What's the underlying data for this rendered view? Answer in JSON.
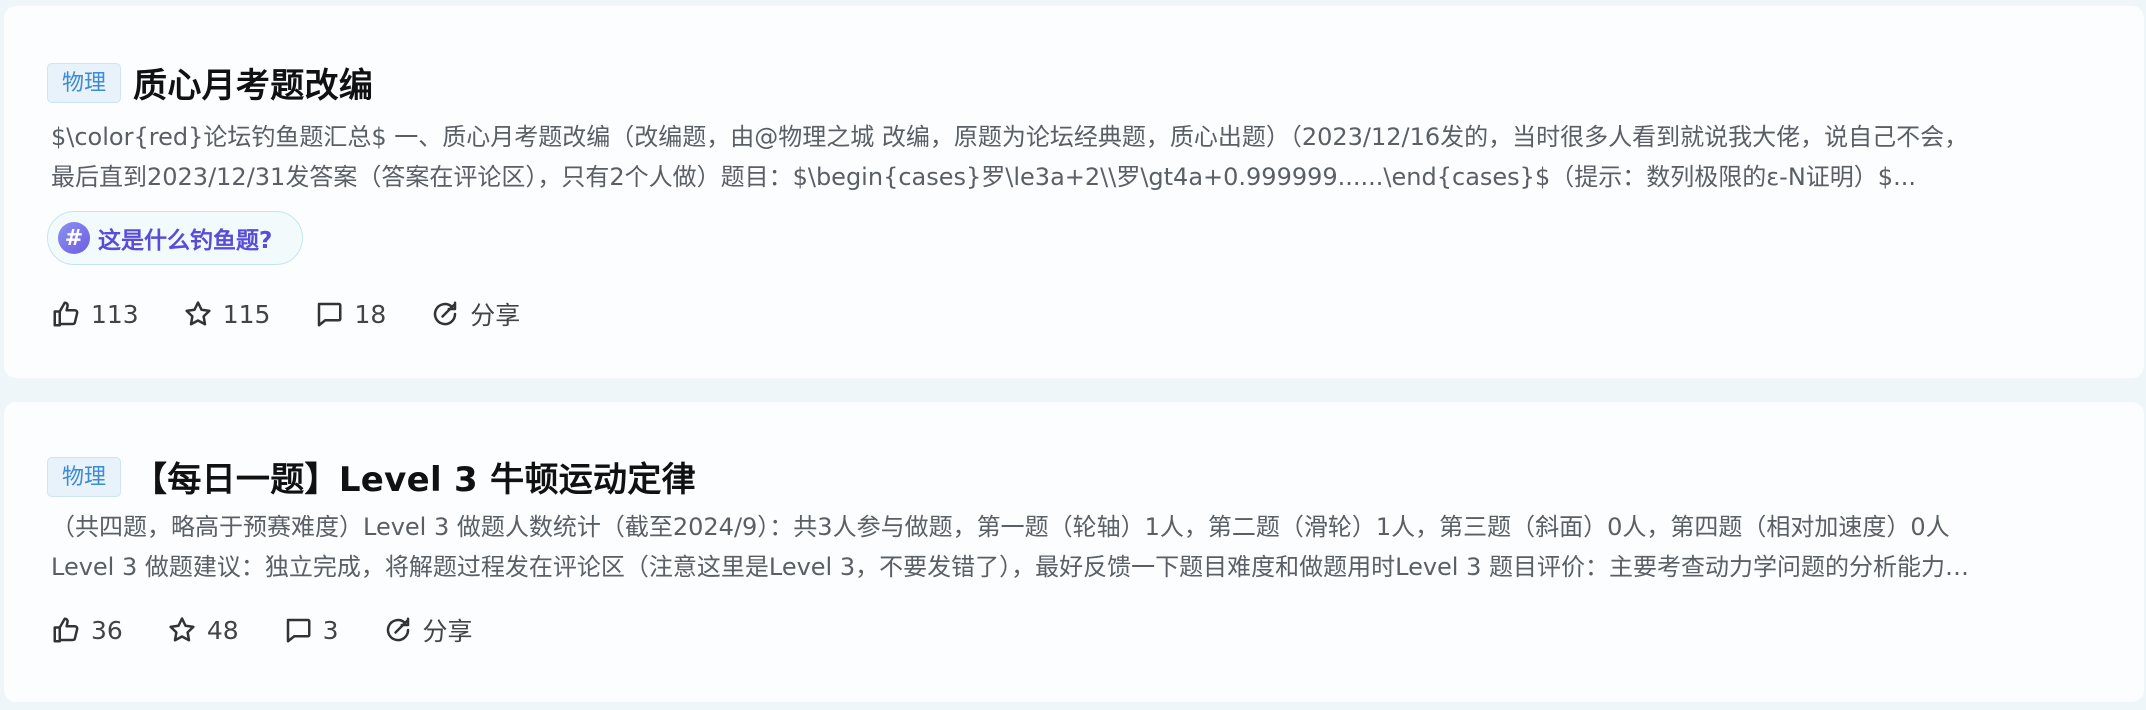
{
  "posts": [
    {
      "tag": "物理",
      "title": "质心月考题改编",
      "summary": [
        "$\\color{red}论坛钓鱼题汇总$  一、质心月考题改编（改编题，由@物理之城 改编，原题为论坛经典题，质心出题）（2023/12/16发的，当时很多人看到就说我大佬，说自己不会，",
        "最后直到2023/12/31发答案（答案在评论区），只有2个人做）题目：$\\begin{cases}罗\\le3a+2\\\\罗\\gt4a+0.999999......\\end{cases}$（提示：数列极限的ε-N证明）$..."
      ],
      "topic": {
        "icon": "#",
        "label": "这是什么钓鱼题?"
      },
      "stats": {
        "likes": "113",
        "favorites": "115",
        "comments": "18",
        "share": "分享"
      }
    },
    {
      "tag": "物理",
      "title": "【每日一题】Level 3 牛顿运动定律",
      "summary": [
        "（共四题，略高于预赛难度）Level 3 做题人数统计（截至2024/9）：共3人参与做题，第一题（轮轴）1人，第二题（滑轮）1人，第三题（斜面）0人，第四题（相对加速度）0人",
        "Level 3 做题建议：独立完成，将解题过程发在评论区（注意这里是Level 3，不要发错了），最好反馈一下题目难度和做题用时Level 3 题目评价：主要考查动力学问题的分析能力…"
      ],
      "stats": {
        "likes": "36",
        "favorites": "48",
        "comments": "3",
        "share": "分享"
      }
    }
  ]
}
